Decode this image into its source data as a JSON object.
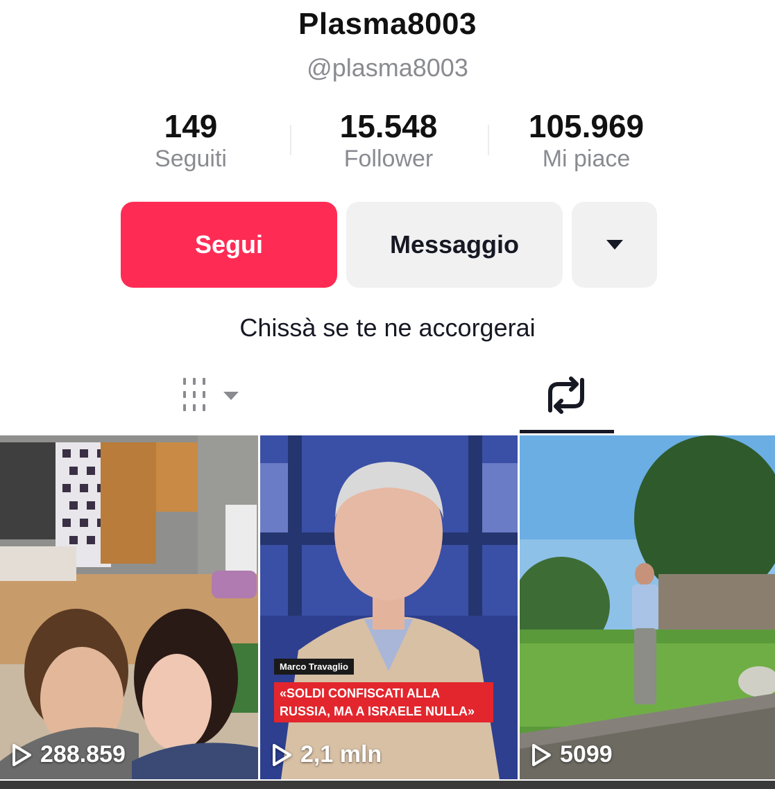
{
  "profile": {
    "display_name": "Plasma8003",
    "username": "@plasma8003",
    "bio": "Chissà se te ne accorgerai"
  },
  "stats": [
    {
      "value": "149",
      "label": "Seguiti"
    },
    {
      "value": "15.548",
      "label": "Follower"
    },
    {
      "value": "105.969",
      "label": "Mi piace"
    }
  ],
  "actions": {
    "follow_label": "Segui",
    "message_label": "Messaggio",
    "more_icon": "caret-down-icon"
  },
  "tabs": {
    "videos_icon": "grid-dropdown-icon",
    "reposts_icon": "repost-icon",
    "active": "reposts"
  },
  "videos": [
    {
      "views": "288.859"
    },
    {
      "views": "2,1 mln",
      "overlay_name": "Marco Travaglio",
      "overlay_headline": "«SOLDI CONFISCATI ALLA RUSSIA, MA A ISRAELE NULLA»"
    },
    {
      "views": "5099"
    }
  ],
  "colors": {
    "accent": "#fe2c55",
    "button_secondary": "#f1f1f2",
    "muted_text": "#8a8b91"
  }
}
